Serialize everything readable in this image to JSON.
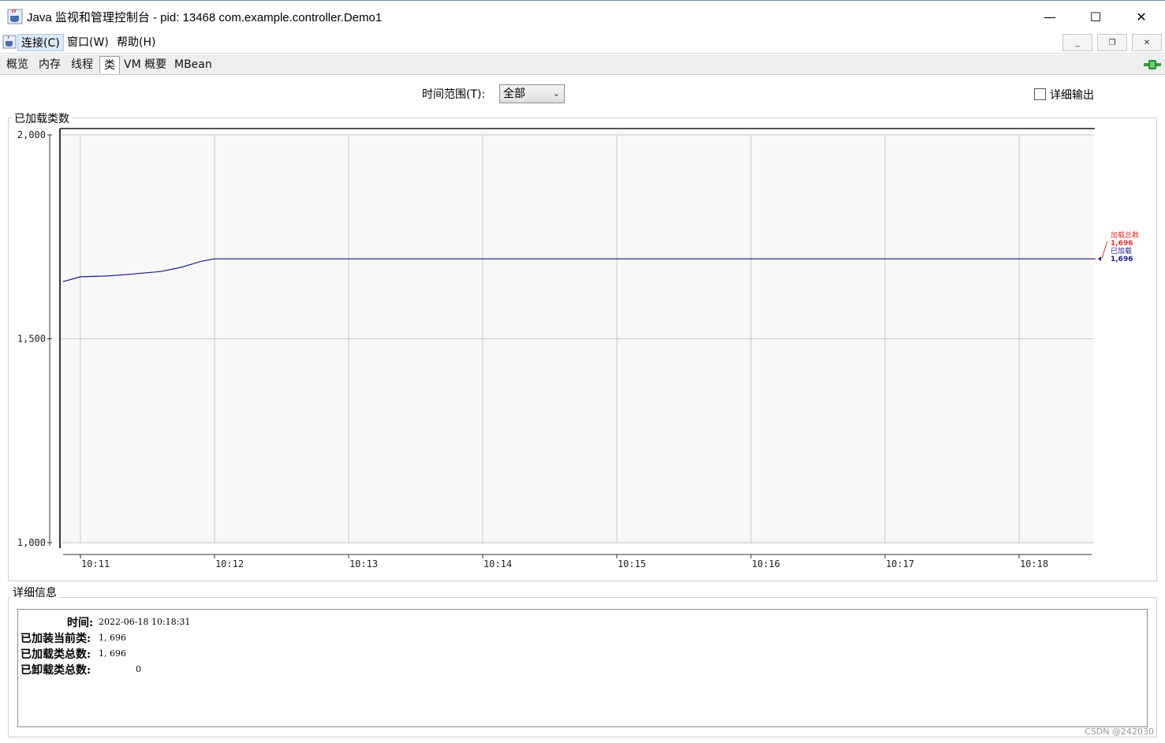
{
  "window": {
    "title": "Java 监视和管理控制台 - pid: 13468 com.example.controller.Demo1",
    "minimize_label": "—",
    "maximize_label": "☐",
    "close_label": "✕"
  },
  "menubar": {
    "items": [
      "连接(C)",
      "窗口(W)",
      "帮助(H)"
    ],
    "active_index": 0,
    "mdi_min": "_",
    "mdi_restore": "❐",
    "mdi_close": "✕"
  },
  "tabs": {
    "items": [
      "概览",
      "内存",
      "线程",
      "类",
      "VM 概要",
      "MBean"
    ],
    "selected_index": 3
  },
  "controls": {
    "time_range_label": "时间范围(T):",
    "time_range_value": "全部",
    "verbose_label": "详细输出",
    "verbose_checked": false
  },
  "loaded_panel": {
    "title": "已加载类数"
  },
  "chart_data": {
    "type": "line",
    "ylim": [
      1000,
      2000
    ],
    "y_ticks": [
      "2,000",
      "1,500",
      "1,000"
    ],
    "y_tick_values": [
      2000,
      1500,
      1000
    ],
    "x_ticks": [
      "10:11",
      "10:12",
      "10:13",
      "10:14",
      "10:15",
      "10:16",
      "10:17",
      "10:18"
    ],
    "x_minutes": [
      0,
      1,
      2,
      3,
      4,
      5,
      6,
      7
    ],
    "x_range_minutes": [
      -0.13,
      7.57
    ],
    "grid": true,
    "series": [
      {
        "name": "已加载",
        "color": "#1a1a8c",
        "x": [
          -0.13,
          0.0,
          0.2,
          0.33,
          0.5,
          0.6,
          0.75,
          0.9,
          1.0,
          1.5,
          2.0,
          3.0,
          4.0,
          5.0,
          6.0,
          7.0,
          7.57
        ],
        "values": [
          1640,
          1652,
          1654,
          1657,
          1662,
          1665,
          1675,
          1690,
          1696,
          1696,
          1696,
          1696,
          1696,
          1696,
          1696,
          1696,
          1696
        ]
      }
    ],
    "legend": [
      {
        "label": "加载总数",
        "value": "1,696",
        "color": "#e03030"
      },
      {
        "label": "已加载",
        "value": "1,696",
        "color": "#1a1a8c"
      }
    ]
  },
  "details": {
    "title": "详细信息",
    "rows": [
      {
        "label": "时间:",
        "value": "2022-06-18 10:18:31"
      },
      {
        "label": "已加装当前类:",
        "value": "1, 696"
      },
      {
        "label": "已加载类总数:",
        "value": "1, 696"
      },
      {
        "label": "已卸载类总数:",
        "value": "0"
      }
    ]
  },
  "watermark": "CSDN @242030"
}
